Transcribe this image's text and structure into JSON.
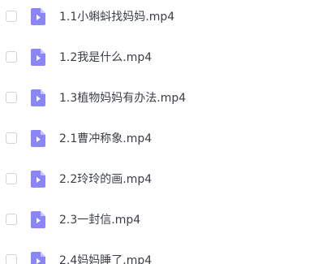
{
  "files": [
    {
      "name": "1.1小蝌蚪找妈妈.mp4",
      "icon": "video-file-icon",
      "checked": false
    },
    {
      "name": "1.2我是什么.mp4",
      "icon": "video-file-icon",
      "checked": false
    },
    {
      "name": "1.3植物妈妈有办法.mp4",
      "icon": "video-file-icon",
      "checked": false
    },
    {
      "name": "2.1曹冲称象.mp4",
      "icon": "video-file-icon",
      "checked": false
    },
    {
      "name": "2.2玲玲的画.mp4",
      "icon": "video-file-icon",
      "checked": false
    },
    {
      "name": "2.3一封信.mp4",
      "icon": "video-file-icon",
      "checked": false
    },
    {
      "name": "2.4妈妈睡了.mp4",
      "icon": "video-file-icon",
      "checked": false
    }
  ],
  "colors": {
    "icon_fill": "#8b86f5",
    "icon_fold": "#c9c6fb",
    "checkbox_border": "#cfd3d8",
    "text": "#3b3f45"
  }
}
